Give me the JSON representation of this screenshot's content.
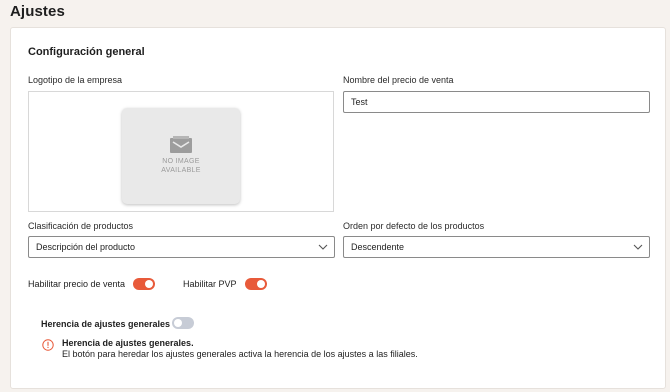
{
  "page": {
    "title": "Ajustes"
  },
  "section": {
    "title": "Configuración general"
  },
  "logo": {
    "label": "Logotipo de la empresa",
    "placeholder_line1": "NO IMAGE",
    "placeholder_line2": "AVAILABLE"
  },
  "sale_price_name": {
    "label": "Nombre del precio de venta",
    "value": "Test"
  },
  "product_classification": {
    "label": "Clasificación de productos",
    "value": "Descripción del producto"
  },
  "default_order": {
    "label": "Orden por defecto de los productos",
    "value": "Descendente"
  },
  "toggles": {
    "sale_price": {
      "label": "Habilitar precio de venta",
      "on": true
    },
    "pvp": {
      "label": "Habilitar PVP",
      "on": true
    },
    "inherit": {
      "label": "Herencia de ajustes generales",
      "on": false
    }
  },
  "info": {
    "title": "Herencia de ajustes generales.",
    "text": "El botón para heredar los ajustes generales activa la herencia de los ajustes a las filiales."
  },
  "colors": {
    "accent": "#e85a3a",
    "toggle_off": "#c7ccd6",
    "page_bg": "#f6f2ee"
  }
}
